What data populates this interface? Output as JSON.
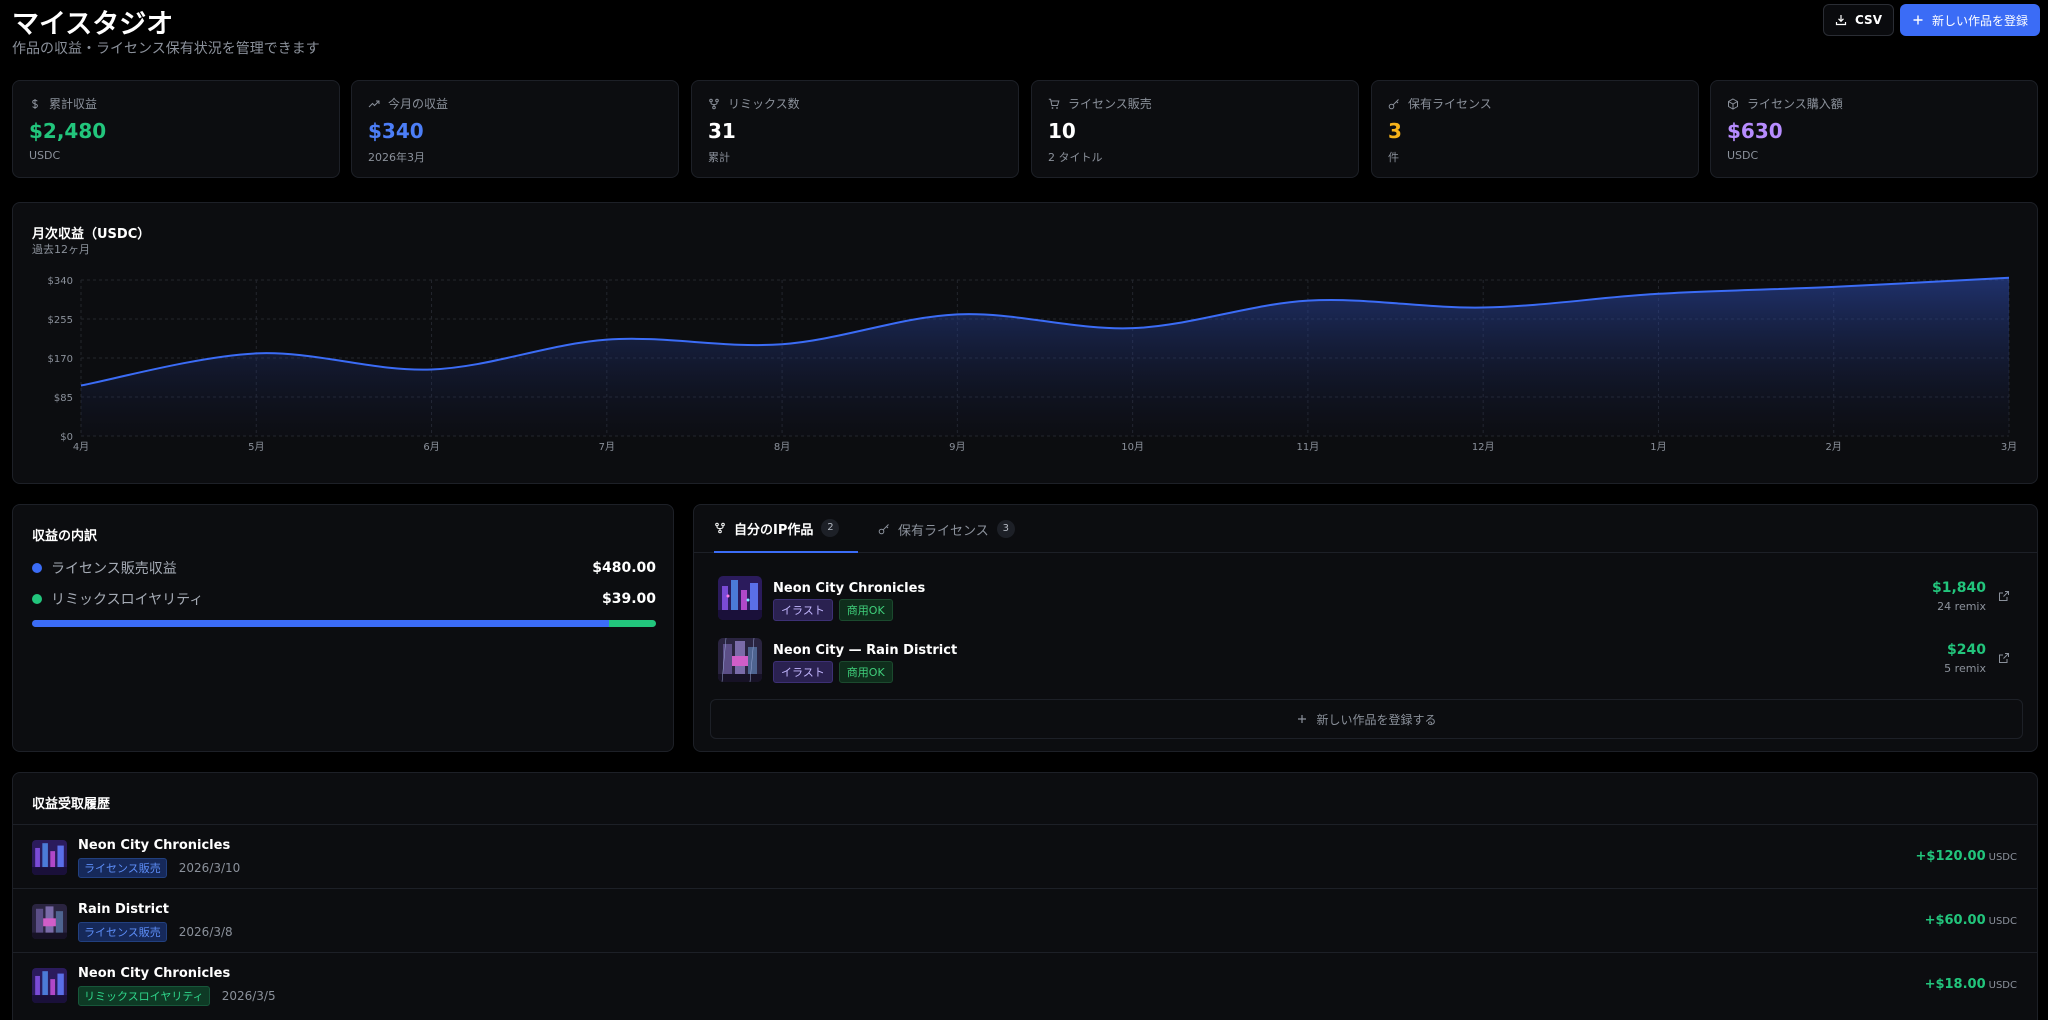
{
  "header": {
    "title": "マイスタジオ",
    "subtitle": "作品の収益・ライセンス保有状況を管理できます",
    "csv_label": "CSV",
    "new_work_label": "新しい作品を登録"
  },
  "stats": [
    {
      "label": "累計収益",
      "value": "$2,480",
      "sub": "USDC",
      "icon": "dollar-icon",
      "color": "#22c57c"
    },
    {
      "label": "今月の収益",
      "value": "$340",
      "sub": "2026年3月",
      "icon": "trending-up-icon",
      "color": "#4c7ef7"
    },
    {
      "label": "リミックス数",
      "value": "31",
      "sub": "累計",
      "icon": "git-fork-icon",
      "color": "#ffffff"
    },
    {
      "label": "ライセンス販売",
      "value": "10",
      "sub": "2 タイトル",
      "icon": "cart-icon",
      "color": "#ffffff"
    },
    {
      "label": "保有ライセンス",
      "value": "3",
      "sub": "件",
      "icon": "key-icon",
      "color": "#f5b21a"
    },
    {
      "label": "ライセンス購入額",
      "value": "$630",
      "sub": "USDC",
      "icon": "package-icon",
      "color": "#b78cff"
    }
  ],
  "chart": {
    "title": "月次収益（USDC）",
    "subtitle": "過去12ヶ月"
  },
  "chart_data": {
    "type": "area",
    "x": [
      "4月",
      "5月",
      "6月",
      "7月",
      "8月",
      "9月",
      "10月",
      "11月",
      "12月",
      "1月",
      "2月",
      "3月"
    ],
    "series": [
      {
        "values": [
          110,
          180,
          145,
          210,
          200,
          265,
          235,
          295,
          280,
          310,
          325,
          345
        ]
      }
    ],
    "ylim": [
      0,
      340
    ],
    "yticks": [
      "$0",
      "$85",
      "$170",
      "$255",
      "$340"
    ],
    "grid": true,
    "line_color": "#3b6cf6"
  },
  "breakdown": {
    "title": "収益の内訳",
    "items": [
      {
        "label": "ライセンス販売収益",
        "value": "$480.00",
        "color": "#3b6cf6"
      },
      {
        "label": "リミックスロイヤリティ",
        "value": "$39.00",
        "color": "#22c57c"
      }
    ],
    "shares": [
      0.925,
      0.075
    ]
  },
  "works": {
    "tabs": [
      {
        "label": "自分のIP作品",
        "count": "2",
        "icon": "git-fork-icon"
      },
      {
        "label": "保有ライセンス",
        "count": "3",
        "icon": "key-icon"
      }
    ],
    "items": [
      {
        "name": "Neon City Chronicles",
        "tags": [
          "イラスト",
          "商用OK"
        ],
        "amount": "$1,840",
        "remix": "24 remix"
      },
      {
        "name": "Neon City — Rain District",
        "tags": [
          "イラスト",
          "商用OK"
        ],
        "amount": "$240",
        "remix": "5 remix"
      }
    ],
    "add_label": "新しい作品を登録する"
  },
  "history": {
    "title": "収益受取履歴",
    "items": [
      {
        "name": "Neon City Chronicles",
        "tag": "ライセンス販売",
        "date": "2026/3/10",
        "amount": "+$120.00",
        "unit": "USDC"
      },
      {
        "name": "Rain District",
        "tag": "ライセンス販売",
        "date": "2026/3/8",
        "amount": "+$60.00",
        "unit": "USDC"
      },
      {
        "name": "Neon City Chronicles",
        "tag": "リミックスロイヤリティ",
        "date": "2026/3/5",
        "amount": "+$18.00",
        "unit": "USDC"
      }
    ]
  }
}
